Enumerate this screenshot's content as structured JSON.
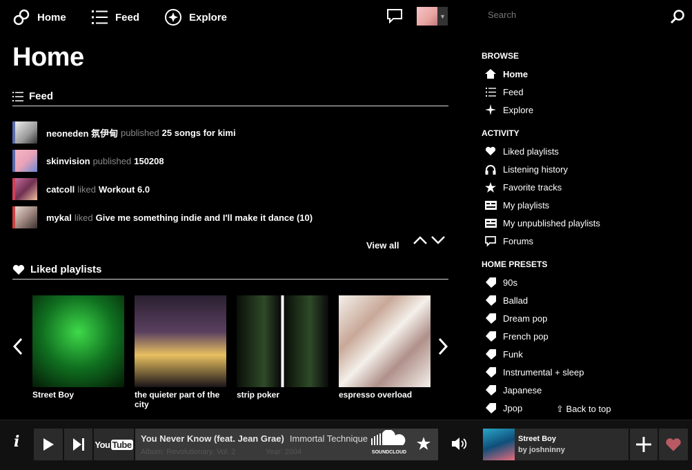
{
  "nav": {
    "home": "Home",
    "feed": "Feed",
    "explore": "Explore"
  },
  "search": {
    "placeholder": "Search"
  },
  "page_title": "Home",
  "feed": {
    "heading": "Feed",
    "items": [
      {
        "user": "neoneden 氛伊甸",
        "action": "published",
        "title": "25 songs for kimi"
      },
      {
        "user": "skinvision",
        "action": "published",
        "title": "150208"
      },
      {
        "user": "catcoll",
        "action": "liked",
        "title": "Workout 6.0"
      },
      {
        "user": "mykal",
        "action": "liked",
        "title": "Give me something indie and I'll make it dance (10)"
      }
    ],
    "view_all": "View all"
  },
  "liked": {
    "heading": "Liked playlists",
    "items": [
      {
        "title": "Street Boy",
        "color": "#1d8a2a"
      },
      {
        "title": "the quieter part of the city",
        "color": "#4a3a5a"
      },
      {
        "title": "strip poker",
        "color": "#1a2a18"
      },
      {
        "title": "espresso overload",
        "color": "#e8e4dc"
      }
    ]
  },
  "sidebar": {
    "browse_head": "BROWSE",
    "browse": [
      "Home",
      "Feed",
      "Explore"
    ],
    "activity_head": "ACTIVITY",
    "activity": [
      "Liked playlists",
      "Listening history",
      "Favorite tracks",
      "My playlists",
      "My unpublished playlists",
      "Forums"
    ],
    "presets_head": "HOME PRESETS",
    "presets": [
      "90s",
      "Ballad",
      "Dream pop",
      "French pop",
      "Funk",
      "Instrumental + sleep",
      "Japanese",
      "Jpop"
    ],
    "back_to_top": "Back to top"
  },
  "player": {
    "info": "i",
    "youtube": "YouTube",
    "track_title": "You Never Know (feat. Jean Grae)",
    "track_artist": "Immortal Technique",
    "album": "Album: Revolutionary, Vol. 2",
    "year": "Year: 2004",
    "soundcloud": "SOUNDCLOUD",
    "now_playing_title": "Street Boy",
    "now_playing_by": "by joshninny"
  }
}
